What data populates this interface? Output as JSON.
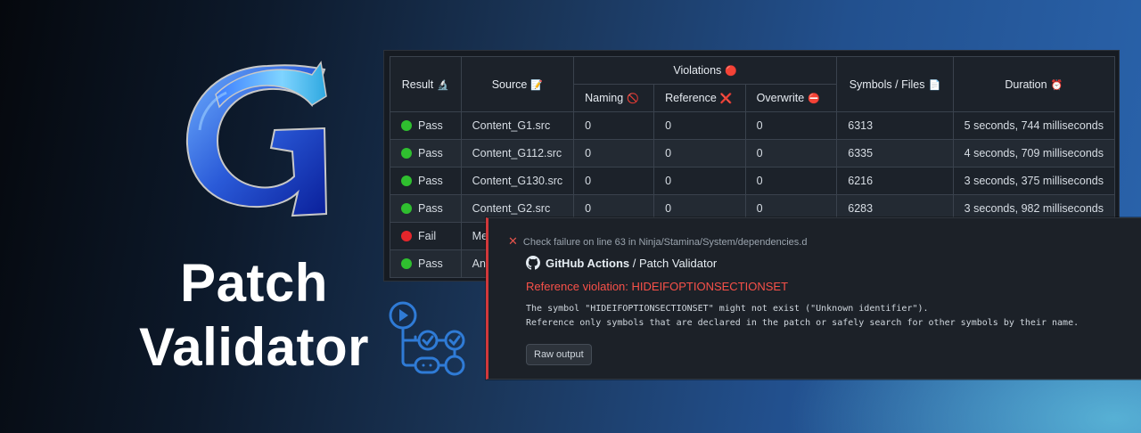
{
  "brand": {
    "title_line1": "Patch",
    "title_line2": "Validator"
  },
  "table": {
    "headers": {
      "result": "Result",
      "result_icon": "🔬",
      "source": "Source",
      "source_icon": "📝",
      "violations": "Violations",
      "violations_icon": "🔴",
      "naming": "Naming",
      "naming_icon": "🚫",
      "reference": "Reference",
      "reference_icon": "❌",
      "overwrite": "Overwrite",
      "overwrite_icon": "⛔",
      "symbols": "Symbols / Files",
      "symbols_icon": "📄",
      "duration": "Duration",
      "duration_icon": "⏰"
    },
    "rows": [
      {
        "status": "pass",
        "result": "Pass",
        "source": "Content_G1.src",
        "naming": "0",
        "reference": "0",
        "overwrite": "0",
        "symbols": "6313",
        "duration": "5 seconds, 744 milliseconds"
      },
      {
        "status": "pass",
        "result": "Pass",
        "source": "Content_G112.src",
        "naming": "0",
        "reference": "0",
        "overwrite": "0",
        "symbols": "6335",
        "duration": "4 seconds, 709 milliseconds"
      },
      {
        "status": "pass",
        "result": "Pass",
        "source": "Content_G130.src",
        "naming": "0",
        "reference": "0",
        "overwrite": "0",
        "symbols": "6216",
        "duration": "3 seconds, 375 milliseconds"
      },
      {
        "status": "pass",
        "result": "Pass",
        "source": "Content_G2.src",
        "naming": "0",
        "reference": "0",
        "overwrite": "0",
        "symbols": "6283",
        "duration": "3 seconds, 982 milliseconds"
      },
      {
        "status": "fail",
        "result": "Fail",
        "source": "Me",
        "naming": "",
        "reference": "",
        "overwrite": "",
        "symbols": "",
        "duration": ""
      },
      {
        "status": "pass",
        "result": "Pass",
        "source": "An",
        "naming": "",
        "reference": "",
        "overwrite": "",
        "symbols": "",
        "duration": ""
      }
    ]
  },
  "annotation": {
    "header": "Check failure on line 63 in Ninja/Stamina/System/dependencies.d",
    "app_name": "GitHub Actions",
    "app_sep": " / ",
    "app_workflow": "Patch Validator",
    "title": "Reference violation: HIDEIFOPTIONSECTIONSET",
    "message_line1": "The symbol \"HIDEIFOPTIONSECTIONSET\" might not exist (\"Unknown identifier\").",
    "message_line2": "Reference only symbols that are declared in the patch or safely search for other symbols by their name.",
    "raw_button": "Raw output"
  },
  "icons": {
    "logo": "gothic-g-logo",
    "actions": "github-actions-workflow-icon",
    "github": "github-mark-icon",
    "error": "close-x-icon"
  },
  "colors": {
    "pass": "#2fbf2f",
    "fail": "#e5262b",
    "error_text": "#f85149",
    "annotation_border": "#d1383b"
  }
}
